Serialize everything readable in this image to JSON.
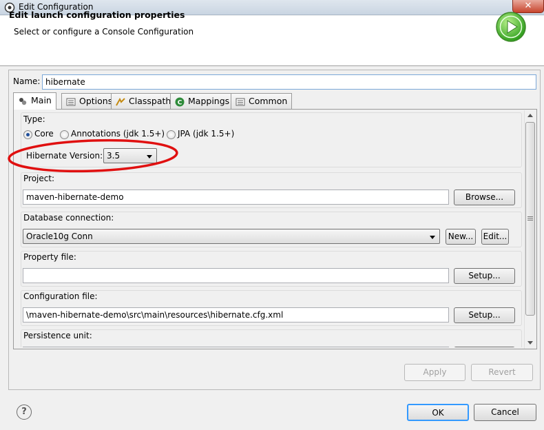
{
  "window": {
    "title": "Edit Configuration",
    "close_glyph": "✕"
  },
  "header": {
    "title": "Edit launch configuration properties",
    "description": "Select or configure a Console Configuration",
    "icon": "run-icon"
  },
  "name_field": {
    "label": "Name:",
    "value": "hibernate"
  },
  "tabs": [
    {
      "label": "Main",
      "icon": "main-tab-icon",
      "selected": true
    },
    {
      "label": "Options",
      "icon": "options-tab-icon"
    },
    {
      "label": "Classpath",
      "icon": "classpath-tab-icon"
    },
    {
      "label": "Mappings",
      "icon": "mappings-tab-icon"
    },
    {
      "label": "Common",
      "icon": "common-tab-icon"
    }
  ],
  "main": {
    "type": {
      "label": "Type:",
      "options": [
        {
          "label": "Core",
          "selected": true
        },
        {
          "label": "Annotations (jdk 1.5+)",
          "selected": false
        },
        {
          "label": "JPA (jdk 1.5+)",
          "selected": false
        }
      ],
      "version_label": "Hibernate Version:",
      "version_value": "3.5"
    },
    "project": {
      "label": "Project:",
      "value": "maven-hibernate-demo",
      "button": "Browse..."
    },
    "database": {
      "label": "Database connection:",
      "value": "Oracle10g Conn",
      "new_button": "New...",
      "edit_button": "Edit..."
    },
    "property_file": {
      "label": "Property file:",
      "value": "",
      "button": "Setup..."
    },
    "config_file": {
      "label": "Configuration file:",
      "value": "\\maven-hibernate-demo\\src\\main\\resources\\hibernate.cfg.xml",
      "button": "Setup..."
    },
    "persistence": {
      "label": "Persistence unit:"
    }
  },
  "actions": {
    "apply": "Apply",
    "revert": "Revert",
    "ok": "OK",
    "cancel": "Cancel",
    "help_glyph": "?"
  },
  "colors": {
    "annotation_ellipse": "#e01010",
    "focus_border": "#3399ff"
  }
}
